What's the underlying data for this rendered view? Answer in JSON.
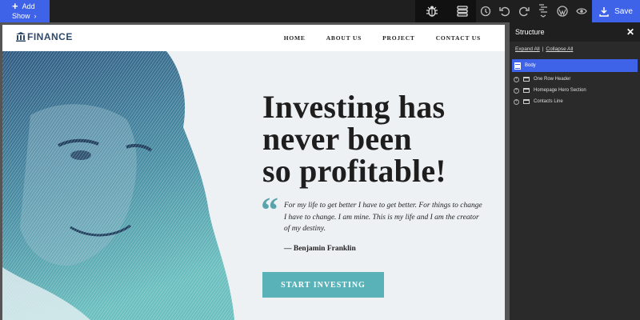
{
  "toolbar": {
    "add_label": "Add",
    "show_label": "Show",
    "save_label": "Save",
    "icons": [
      "bug-icon",
      "layers-icon",
      "history-icon",
      "undo-icon",
      "redo-icon",
      "structure-icon",
      "wordpress-icon",
      "preview-icon"
    ]
  },
  "site": {
    "logo_text": "FINANCE",
    "nav": [
      "HOME",
      "ABOUT US",
      "PROJECT",
      "CONTACT US"
    ],
    "hero": {
      "title_lines": [
        "Investing has",
        "never been",
        "so profitable!"
      ],
      "quote": "For my life to get better I have to get better. For things to change I have to change. I am mine. This is my life and I am the creator of my destiny.",
      "author": "— Benjamin Franklin",
      "cta": "START INVESTING"
    }
  },
  "panel": {
    "title": "Structure",
    "expand_all": "Expand All",
    "separator": "|",
    "collapse_all": "Collapse All",
    "items": [
      {
        "label": "Body",
        "selected": true
      },
      {
        "label": "One Row Header"
      },
      {
        "label": "Homepage Hero Section"
      },
      {
        "label": "Contacts Line"
      }
    ]
  },
  "colors": {
    "accent": "#3e62e8",
    "teal": "#5ab2b9",
    "navy": "#2f4a6b"
  }
}
